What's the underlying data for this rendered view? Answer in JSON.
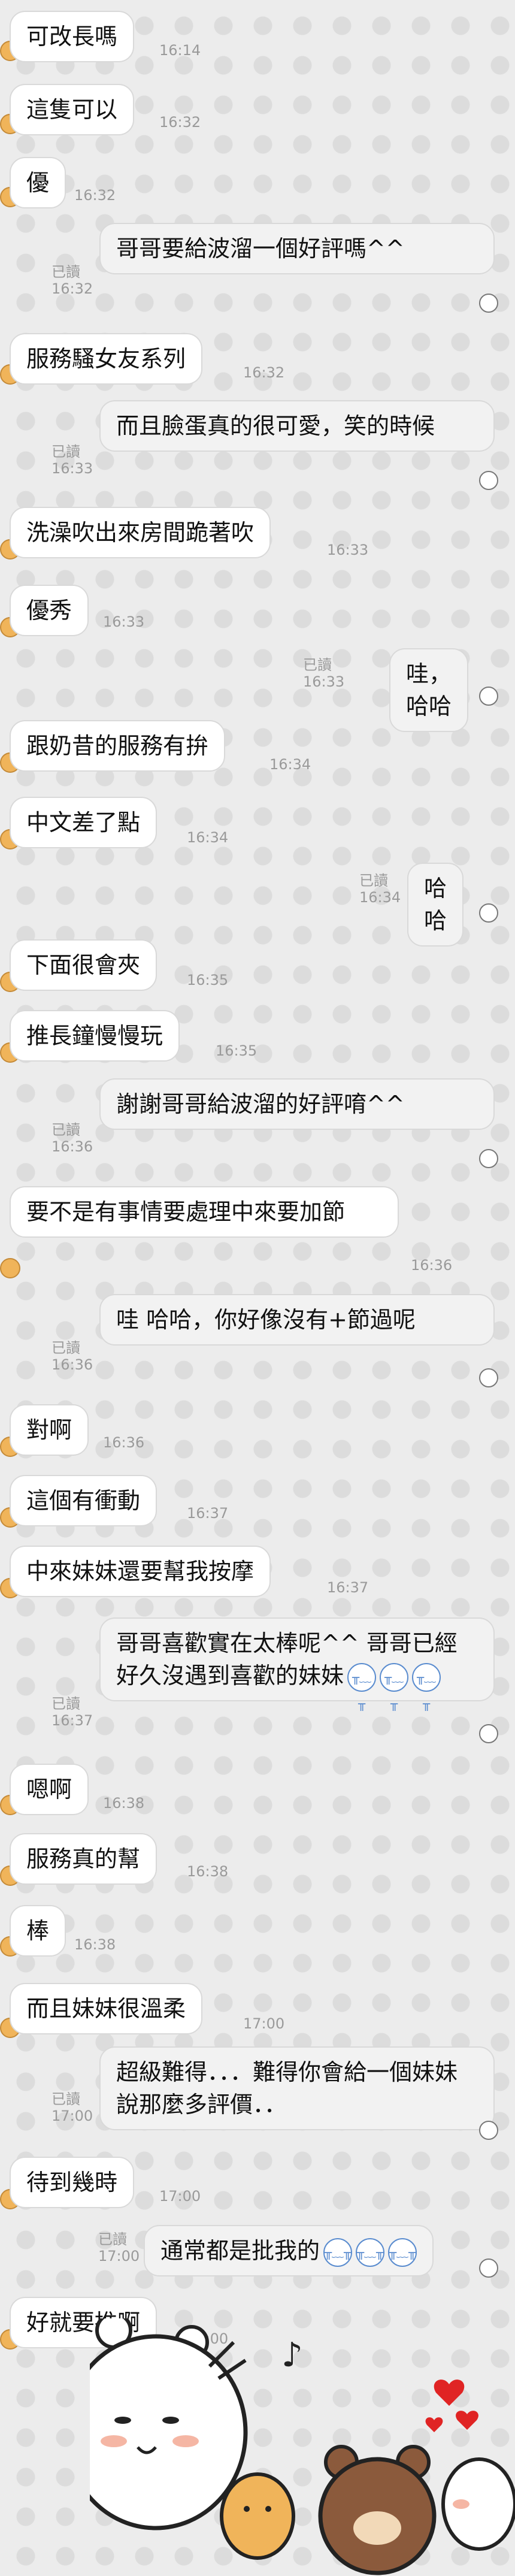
{
  "read_label": "已讀",
  "messages": [
    {
      "dir": "in",
      "text": "可改長嗎",
      "time": "16:14"
    },
    {
      "dir": "in",
      "text": "這隻可以",
      "time": "16:32"
    },
    {
      "dir": "in",
      "text": "優",
      "time": "16:32"
    },
    {
      "dir": "out",
      "text": "哥哥要給波溜一個好評嗎^^",
      "time": "16:32"
    },
    {
      "dir": "in",
      "text": "服務騷女友系列",
      "time": "16:32"
    },
    {
      "dir": "out",
      "text": "而且臉蛋真的很可愛，笑的時候",
      "time": "16:33"
    },
    {
      "dir": "in",
      "text": "洗澡吹出來房間跪著吹",
      "time": "16:33"
    },
    {
      "dir": "in",
      "text": "優秀",
      "time": "16:33"
    },
    {
      "dir": "out",
      "text": "哇，哈哈",
      "time": "16:33"
    },
    {
      "dir": "in",
      "text": "跟奶昔的服務有拚",
      "time": "16:34"
    },
    {
      "dir": "in",
      "text": "中文差了點",
      "time": "16:34"
    },
    {
      "dir": "out",
      "text": "哈哈",
      "time": "16:34"
    },
    {
      "dir": "in",
      "text": "下面很會夾",
      "time": "16:35"
    },
    {
      "dir": "in",
      "text": "推長鐘慢慢玩",
      "time": "16:35"
    },
    {
      "dir": "out",
      "text": "謝謝哥哥給波溜的好評唷^^",
      "time": "16:36"
    },
    {
      "dir": "in",
      "text": "要不是有事情要處理中來要加節",
      "time": "16:36"
    },
    {
      "dir": "out",
      "text": "哇 哈哈，你好像沒有+節過呢",
      "time": "16:36"
    },
    {
      "dir": "in",
      "text": "對啊",
      "time": "16:36"
    },
    {
      "dir": "in",
      "text": "這個有衝動",
      "time": "16:37"
    },
    {
      "dir": "in",
      "text": "中來妹妹還要幫我按摩",
      "time": "16:37"
    },
    {
      "dir": "out",
      "text": "哥哥喜歡實在太棒呢^^ 哥哥已經好久沒遇到喜歡的妹妹",
      "time": "16:37"
    },
    {
      "dir": "in",
      "text": "嗯啊",
      "time": "16:38"
    },
    {
      "dir": "in",
      "text": "服務真的幫",
      "time": "16:38"
    },
    {
      "dir": "in",
      "text": "棒",
      "time": "16:38"
    },
    {
      "dir": "in",
      "text": "而且妹妹很溫柔",
      "time": "17:00"
    },
    {
      "dir": "out",
      "text": "超級難得．．．難得你會給一個妹妹說那麼多評價．．",
      "time": "17:00"
    },
    {
      "dir": "in",
      "text": "待到幾時",
      "time": "17:00"
    },
    {
      "dir": "out",
      "text": "通常都是批我的",
      "time": "17:00"
    },
    {
      "dir": "in",
      "text": "好就要推啊",
      "time": "17:00"
    }
  ]
}
